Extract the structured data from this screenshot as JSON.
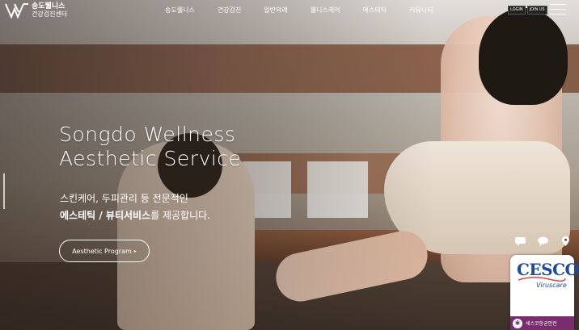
{
  "header": {
    "logo": {
      "line1": "송도웰니스",
      "line2": "건강검진센터"
    },
    "nav": [
      "송도웰니스",
      "건강검진",
      "일반외래",
      "웰니스케어",
      "에스테틱",
      "커뮤니티"
    ],
    "auth": {
      "login": "LOGIN",
      "join": "JOIN US"
    }
  },
  "hero": {
    "title_line1": "Songdo Wellness",
    "title_line2": "Aesthetic Service",
    "desc_line1": "스킨케어, 두피관리 등 전문적인",
    "desc_line2_bold": "에스테틱 / 뷰티서비스",
    "desc_line2_rest": "를 제공합니다.",
    "cta_label": "Aesthetic Program",
    "cta_arrow": "▸"
  },
  "quick_icons": [
    "chat-icon",
    "kakao-icon",
    "location-icon"
  ],
  "cesco": {
    "brand": "CESCO",
    "sub": "Viruscare",
    "ribbon": "세스코항균안전"
  },
  "colors": {
    "cesco_blue": "#1b4b9e",
    "cesco_purple": "#7a2d6e"
  }
}
